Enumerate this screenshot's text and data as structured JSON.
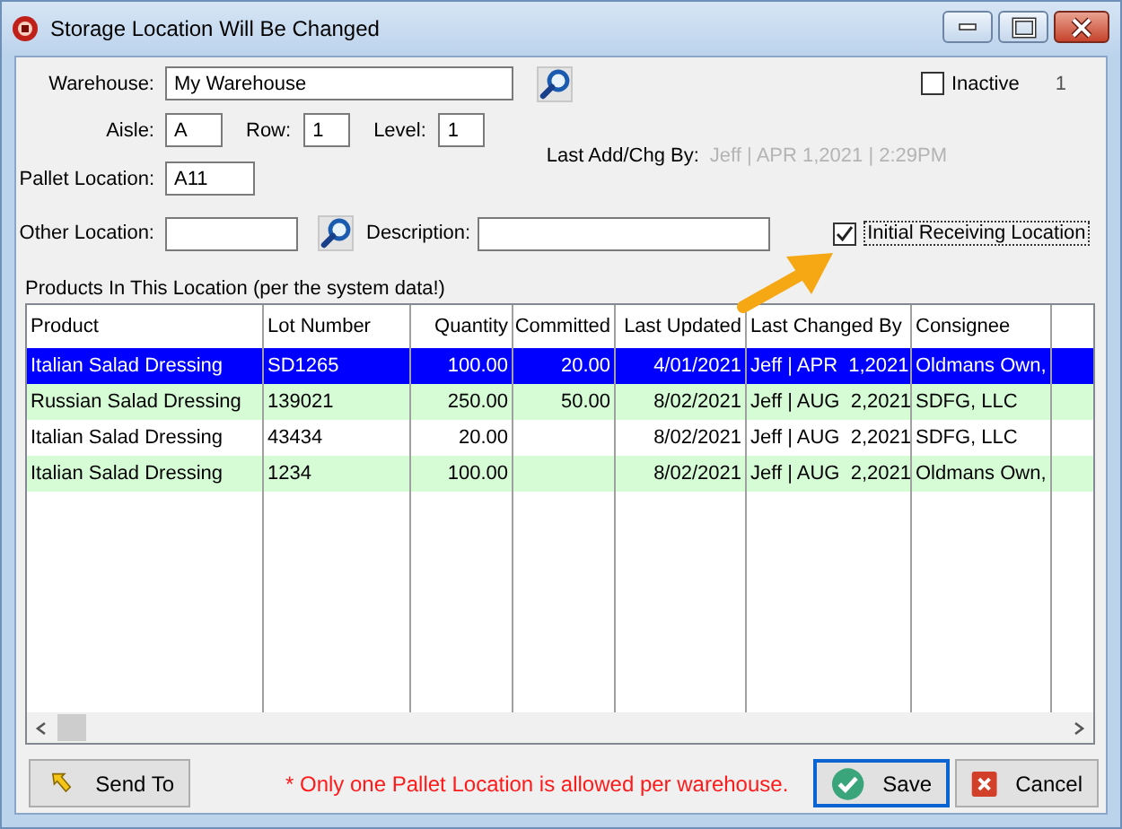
{
  "window": {
    "title": "Storage Location Will Be Changed",
    "controls": [
      {
        "kind": "minimize"
      },
      {
        "kind": "maximize"
      },
      {
        "kind": "close"
      }
    ]
  },
  "warehouse": {
    "label": "Warehouse:",
    "value": "My Warehouse"
  },
  "inactive": {
    "label": "Inactive",
    "checked": false
  },
  "record_number": "1",
  "aisle": {
    "label": "Aisle:",
    "value": "A"
  },
  "row": {
    "label": "Row:",
    "value": "1"
  },
  "level": {
    "label": "Level:",
    "value": "1"
  },
  "last_change": {
    "label": "Last Add/Chg By:",
    "value": "Jeff | APR  1,2021 |  2:29PM"
  },
  "pallet_location": {
    "label": "Pallet Location:",
    "value": "A11"
  },
  "other_location": {
    "label": "Other Location:"
  },
  "description": {
    "label": "Description:"
  },
  "initial_receiving": {
    "label": "Initial Receiving Location",
    "checked": true,
    "focused": true
  },
  "products_caption": "Products In This Location (per the system data!)",
  "table": {
    "columns": [
      {
        "label": "Product"
      },
      {
        "label": "Lot Number"
      },
      {
        "label": "Quantity"
      },
      {
        "label": "Committed"
      },
      {
        "label": "Last Updated"
      },
      {
        "label": "Last Changed By"
      },
      {
        "label": "Consignee"
      }
    ],
    "rows": [
      {
        "selected": true,
        "cells": [
          "Italian Salad Dressing",
          "SD1265",
          "100.00",
          "20.00",
          "4/01/2021",
          "Jeff | APR  1,2021",
          "Oldmans Own,"
        ]
      },
      {
        "selected": false,
        "cells": [
          "Russian Salad Dressing",
          "139021",
          "250.00",
          "50.00",
          "8/02/2021",
          "Jeff | AUG  2,2021",
          "SDFG, LLC"
        ]
      },
      {
        "selected": false,
        "cells": [
          "Italian Salad Dressing",
          "43434",
          "20.00",
          "",
          "8/02/2021",
          "Jeff | AUG  2,2021",
          "SDFG, LLC"
        ]
      },
      {
        "selected": false,
        "cells": [
          "Italian Salad Dressing",
          "1234",
          "100.00",
          "",
          "8/02/2021",
          "Jeff | AUG  2,2021",
          "Oldmans Own,"
        ]
      }
    ]
  },
  "note": "* Only one Pallet Location is allowed per warehouse.",
  "buttons": [
    {
      "kind": "send",
      "label": "Send To",
      "default": false
    },
    {
      "kind": "save",
      "label": "Save",
      "default": true
    },
    {
      "kind": "cancel",
      "label": "Cancel",
      "default": false
    }
  ]
}
